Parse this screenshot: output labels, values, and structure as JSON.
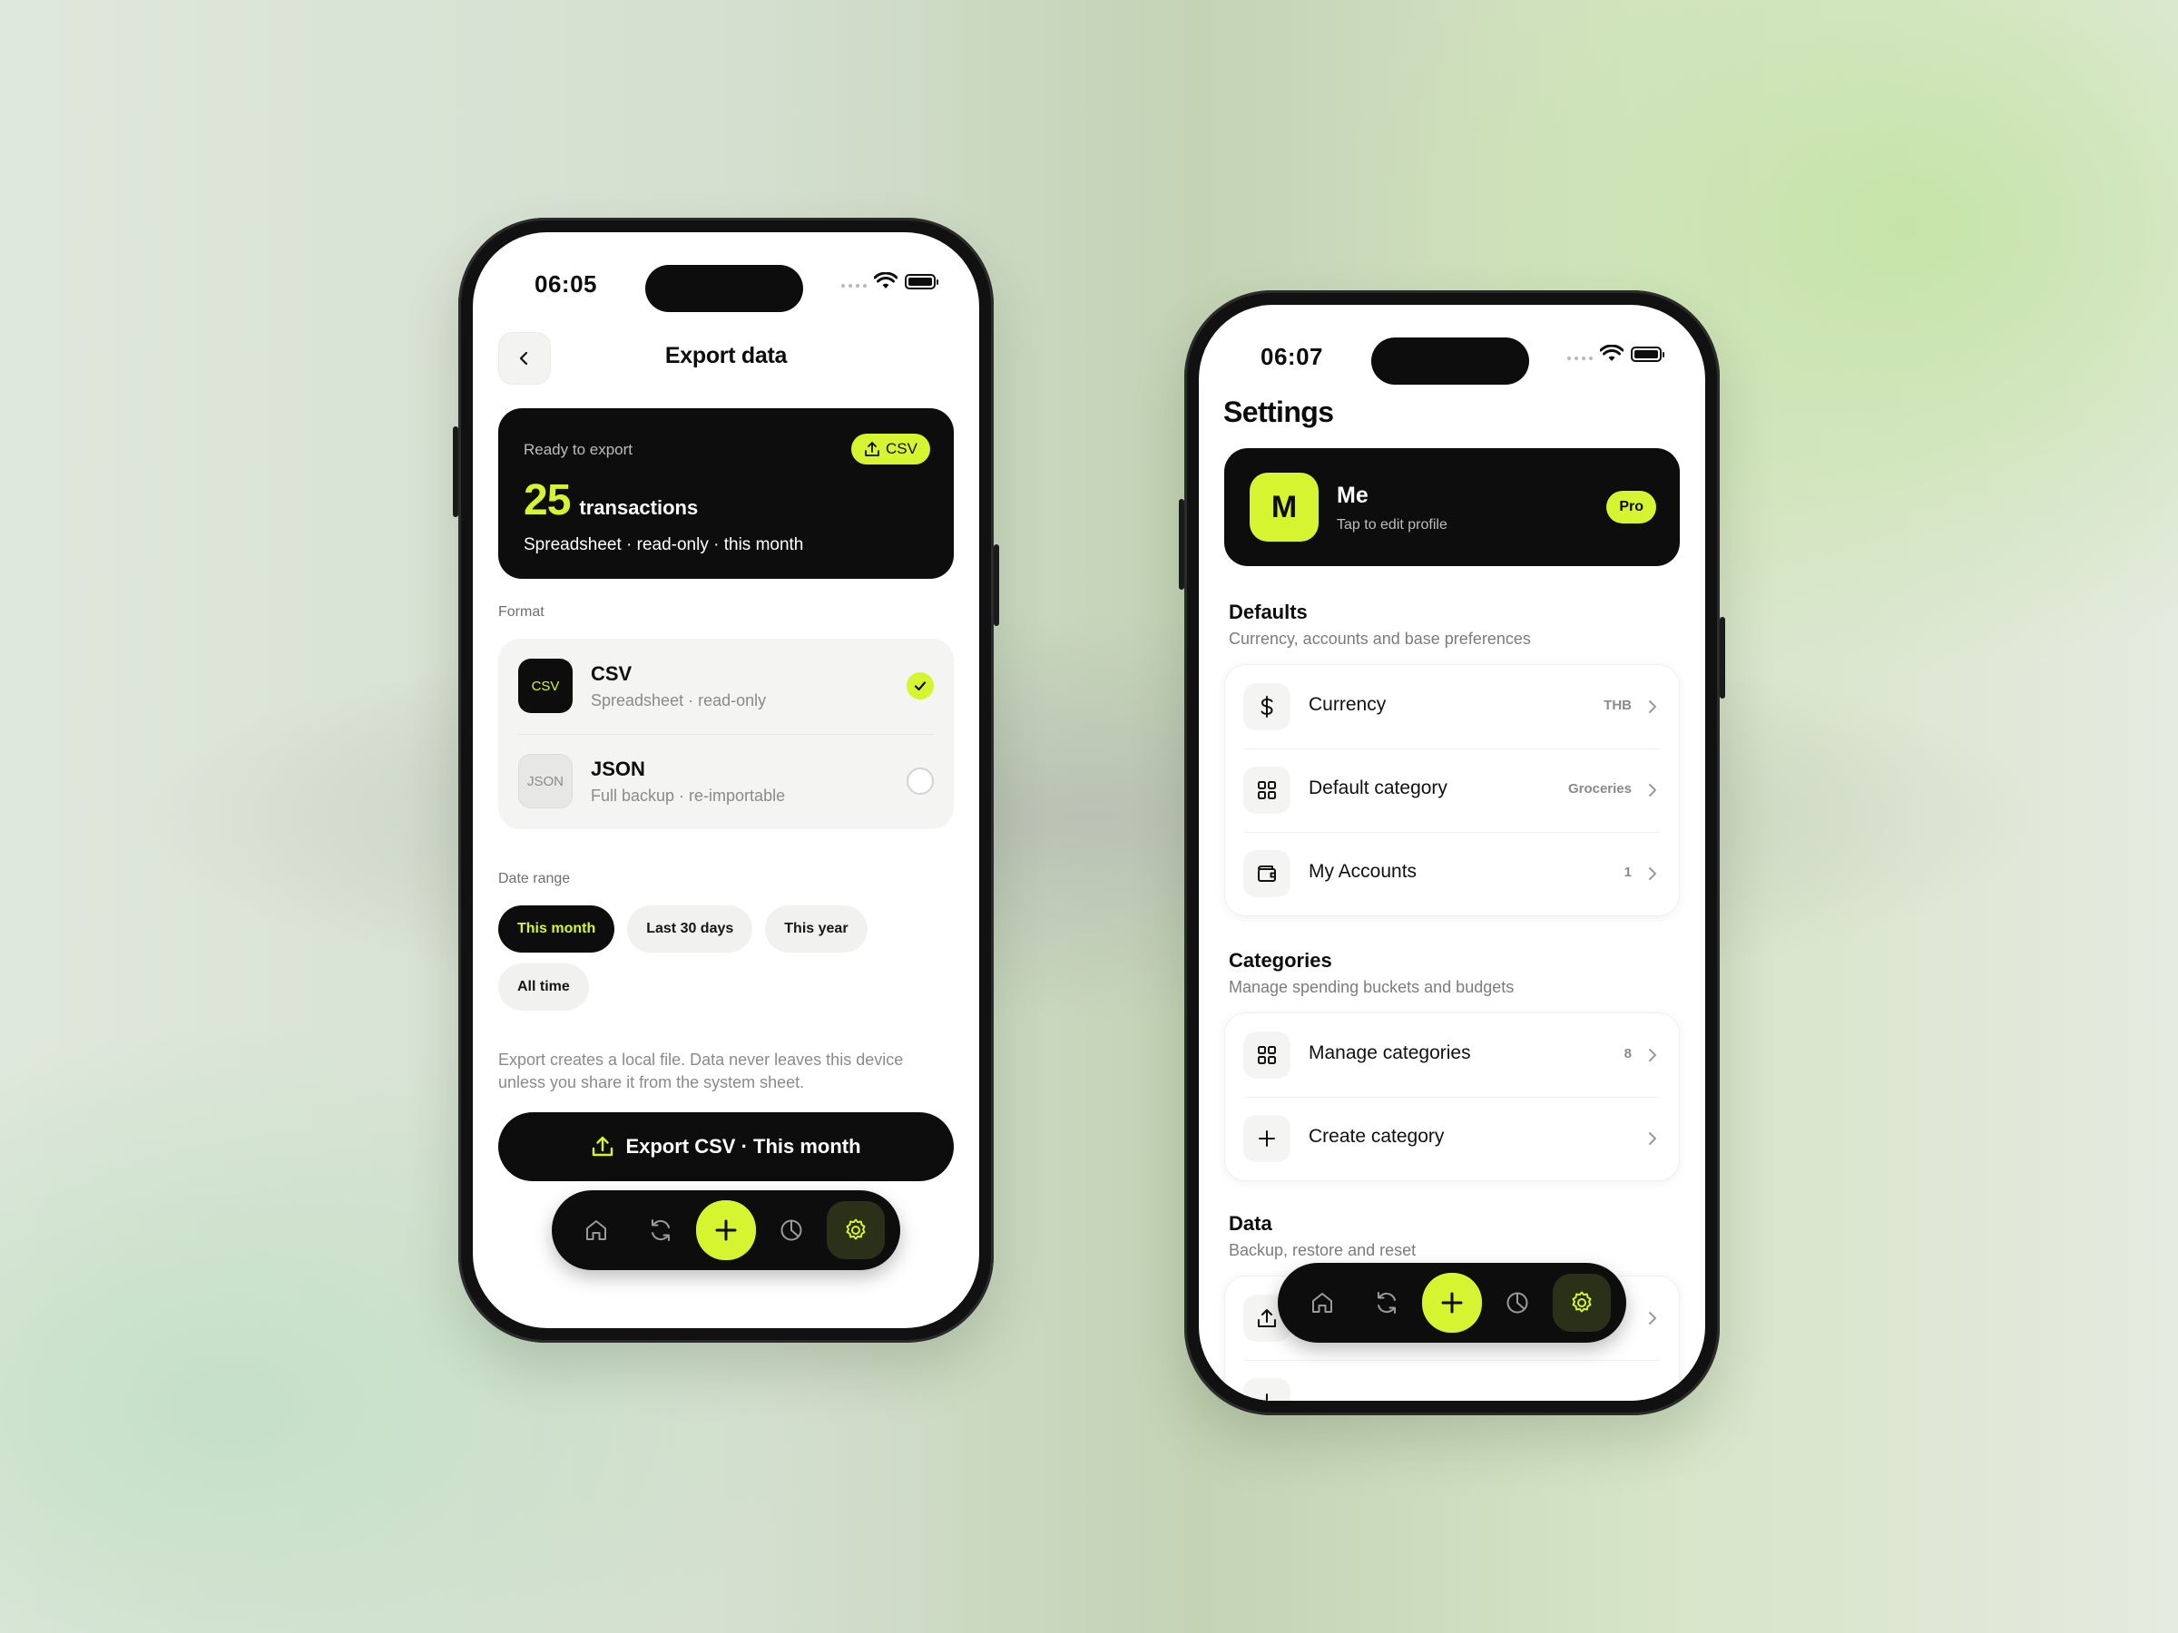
{
  "colors": {
    "accent": "#d6f530",
    "dark": "#0d0d0d"
  },
  "export_screen": {
    "status_time": "06:05",
    "title": "Export data",
    "card": {
      "ready_label": "Ready to export",
      "format_chip": "CSV",
      "count": "25",
      "count_label": "transactions",
      "subtitle": "Spreadsheet · read-only · this month"
    },
    "format_label": "Format",
    "formats": [
      {
        "badge": "CSV",
        "name": "CSV",
        "desc": "Spreadsheet · read-only",
        "selected": true
      },
      {
        "badge": "JSON",
        "name": "JSON",
        "desc": "Full backup · re-importable",
        "selected": false
      }
    ],
    "date_range_label": "Date range",
    "date_ranges": [
      "This month",
      "Last 30 days",
      "This year",
      "All time"
    ],
    "selected_range": "This month",
    "note": "Export creates a local file. Data never leaves this device unless you share it from the system sheet.",
    "export_button": "Export CSV · This month",
    "tabbar": {
      "tabs": [
        "home-icon",
        "refresh-icon",
        "add-icon",
        "pie-chart-icon",
        "settings-icon"
      ],
      "active": "settings-icon"
    }
  },
  "settings_screen": {
    "status_time": "06:07",
    "title": "Settings",
    "profile": {
      "initial": "M",
      "name": "Me",
      "subtitle": "Tap to edit profile",
      "badge": "Pro"
    },
    "defaults": {
      "title": "Defaults",
      "subtitle": "Currency, accounts and base preferences",
      "rows": [
        {
          "icon": "dollar-icon",
          "label": "Currency",
          "value": "THB"
        },
        {
          "icon": "grid-icon",
          "label": "Default category",
          "value": "Groceries"
        },
        {
          "icon": "wallet-icon",
          "label": "My Accounts",
          "value": "1"
        }
      ]
    },
    "categories": {
      "title": "Categories",
      "subtitle": "Manage spending buckets and budgets",
      "rows": [
        {
          "icon": "grid-icon",
          "label": "Manage categories",
          "value": "8"
        },
        {
          "icon": "plus-icon",
          "label": "Create category",
          "value": ""
        }
      ]
    },
    "data": {
      "title": "Data",
      "subtitle": "Backup, restore and reset",
      "rows": [
        {
          "icon": "upload-icon",
          "label": "",
          "value": ""
        },
        {
          "icon": "plus-icon",
          "label": "",
          "value": ""
        }
      ]
    },
    "tabbar": {
      "tabs": [
        "home-icon",
        "refresh-icon",
        "add-icon",
        "pie-chart-icon",
        "settings-icon"
      ],
      "active": "settings-icon"
    }
  }
}
